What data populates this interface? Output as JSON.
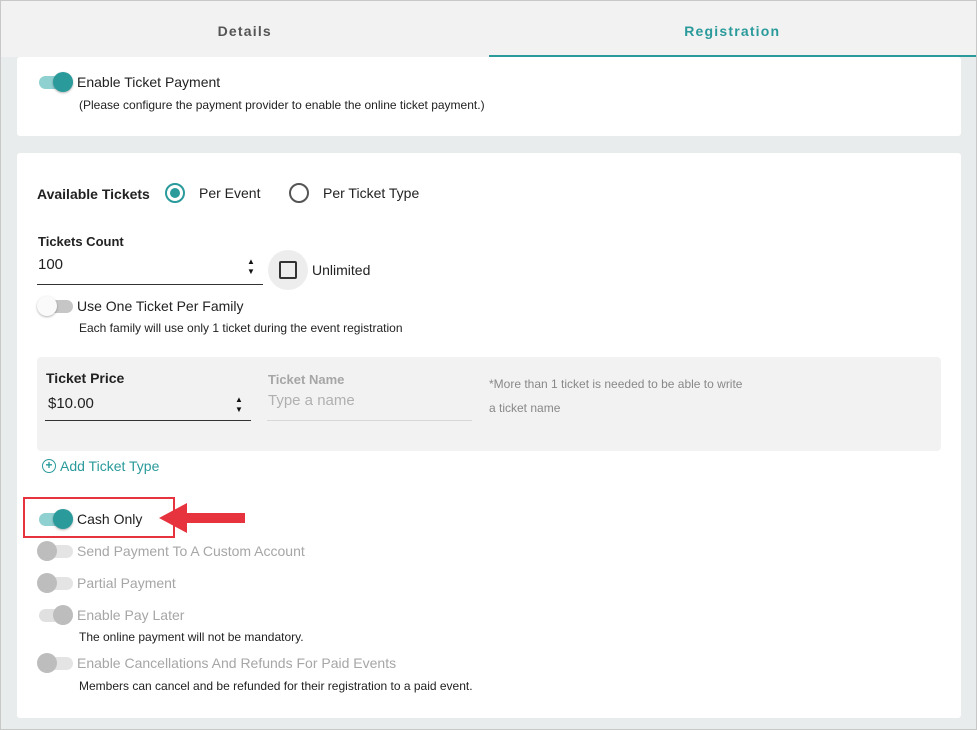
{
  "tabs": {
    "details": "Details",
    "registration": "Registration"
  },
  "payment": {
    "enable_label": "Enable Ticket Payment",
    "enable_helper": "(Please configure the payment provider to enable the online ticket payment.)"
  },
  "tickets": {
    "available_label": "Available Tickets",
    "per_event_label": "Per Event",
    "per_ticket_type_label": "Per Ticket Type",
    "count_label": "Tickets Count",
    "count_value": "100",
    "unlimited_label": "Unlimited",
    "one_per_family_label": "Use One Ticket Per Family",
    "one_per_family_helper": "Each family will use only 1 ticket during the event registration"
  },
  "ticket_type": {
    "price_label": "Ticket Price",
    "price_value": "$10.00",
    "name_label": "Ticket Name",
    "name_placeholder": "Type a name",
    "note_line1": "*More than 1 ticket is needed to be able to write",
    "note_line2": "a ticket name",
    "add_label": "Add Ticket Type"
  },
  "options": {
    "cash_only": "Cash Only",
    "custom_account": "Send Payment To A Custom Account",
    "partial_payment": "Partial Payment",
    "pay_later": "Enable Pay Later",
    "pay_later_helper": "The online payment will not be mandatory.",
    "cancellations": "Enable Cancellations And Refunds For Paid Events",
    "cancellations_helper": "Members can cancel and be refunded for their registration to a paid event."
  },
  "colors": {
    "accent": "#2a9a9b",
    "annotation": "#e6333d"
  },
  "icons": {
    "add": "plus-circle-icon",
    "arrow": "red-arrow-annotation"
  }
}
